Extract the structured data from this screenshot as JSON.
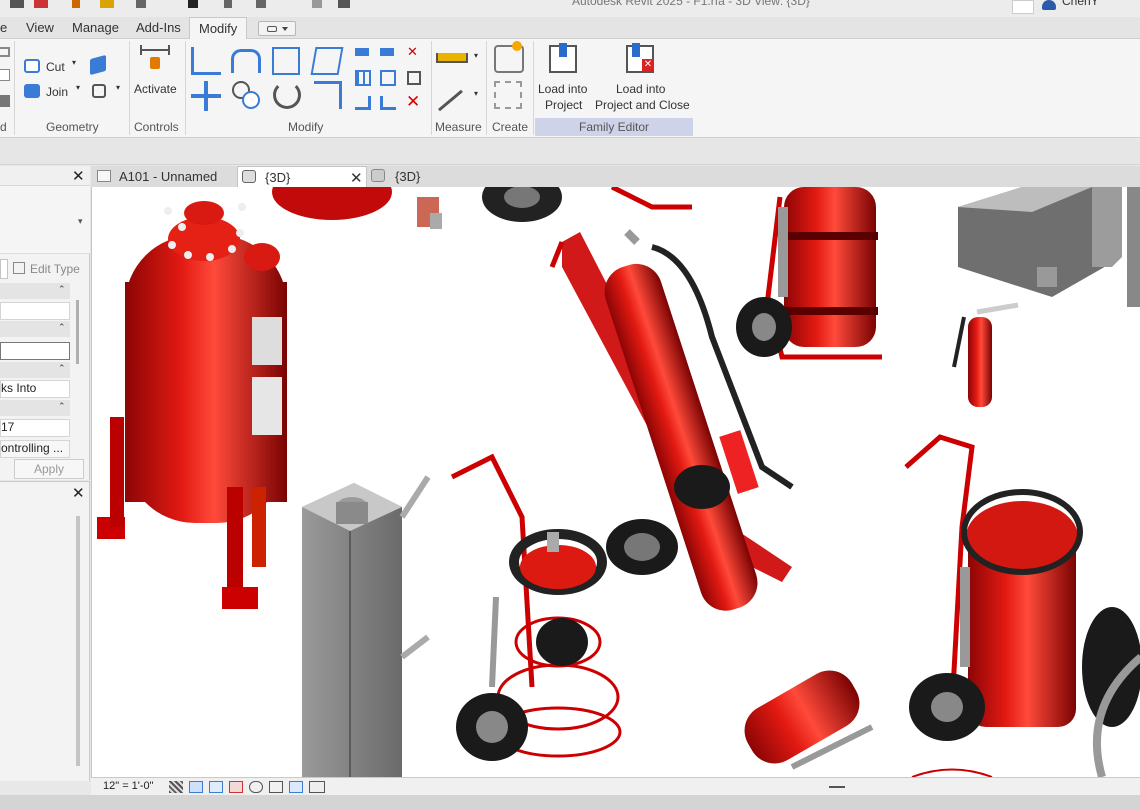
{
  "app": {
    "title": "Autodesk Revit 2025 - F1.rfa - 3D View: {3D}",
    "user": "ChenY"
  },
  "ribbon_tabs": [
    "e",
    "View",
    "Manage",
    "Add-Ins",
    "Modify"
  ],
  "ribbon": {
    "geometry": {
      "cut_label": "Cut",
      "join_label": "Join",
      "panel_label": "Geometry"
    },
    "controls": {
      "activate_label": "Activate",
      "panel_label": "Controls"
    },
    "modify": {
      "panel_label": "Modify"
    },
    "measure": {
      "panel_label": "Measure"
    },
    "create": {
      "panel_label": "Create"
    },
    "family_editor": {
      "load_project_line1": "Load into",
      "load_project_line2": "Project",
      "load_close_line1": "Load into",
      "load_close_line2": "Project and Close",
      "panel_label": "Family Editor"
    },
    "partial_left_label": "d"
  },
  "properties": {
    "edit_type_label": "Edit Type",
    "row_hosted": "ks Into",
    "row_number": "17",
    "row_controlling": "ontrolling ...",
    "apply_label": "Apply"
  },
  "view_tabs": [
    {
      "label": "A101 - Unnamed",
      "icon": "sheet-icon"
    },
    {
      "label": "{3D}",
      "icon": "3d-view-icon"
    },
    {
      "label": "{3D}",
      "icon": "3d-view-icon"
    }
  ],
  "view_bar": {
    "scale": "12\" = 1'-0\""
  },
  "colors": {
    "accent": "#cfd3e9",
    "extinguisher_red": "#d01010",
    "concrete_gray": "#7a7a7a"
  }
}
